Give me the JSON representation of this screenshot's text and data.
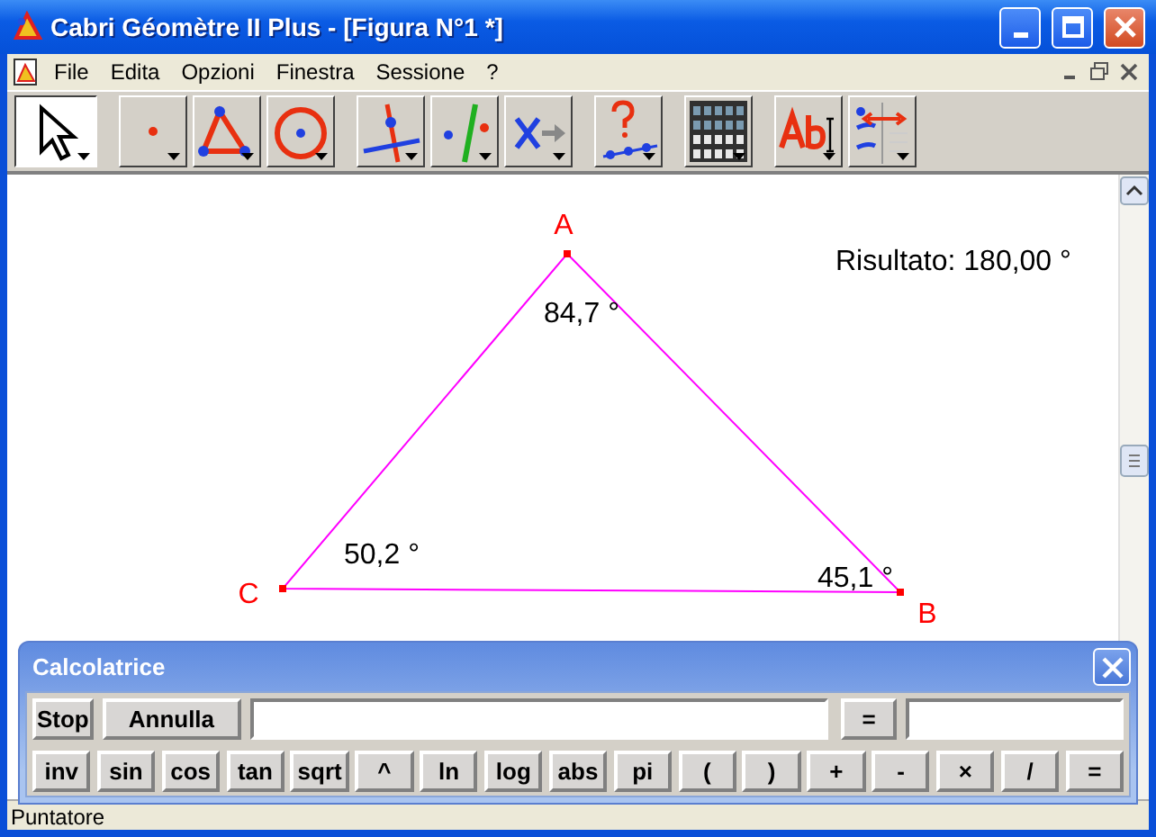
{
  "window": {
    "title": "Cabri Géomètre II Plus - [Figura N°1 *]"
  },
  "menu": [
    "File",
    "Edita",
    "Opzioni",
    "Finestra",
    "Sessione",
    "?"
  ],
  "toolbar": [
    {
      "kind": "pointer",
      "selected": true
    },
    {
      "kind": "point",
      "selected": false
    },
    {
      "kind": "polygon",
      "selected": false
    },
    {
      "kind": "circle",
      "selected": false
    },
    {
      "kind": "lines",
      "selected": false
    },
    {
      "kind": "parallel",
      "selected": false
    },
    {
      "kind": "transform",
      "selected": false
    },
    {
      "kind": "macro",
      "selected": false
    },
    {
      "kind": "calculator",
      "selected": false
    },
    {
      "kind": "text",
      "selected": false
    },
    {
      "kind": "display",
      "selected": false
    }
  ],
  "canvas": {
    "points": [
      {
        "label": "A"
      },
      {
        "label": "B"
      },
      {
        "label": "C"
      }
    ],
    "angles": [
      "84,7 °",
      "50,2 °",
      "45,1 °"
    ],
    "result": "Risultato: 180,00 °"
  },
  "calculator": {
    "title": "Calcolatrice",
    "actions": [
      "Stop",
      "Annulla"
    ],
    "equals": "=",
    "keys": [
      "inv",
      "sin",
      "cos",
      "tan",
      "sqrt",
      "^",
      "ln",
      "log",
      "abs",
      "pi",
      "(",
      ")",
      "+",
      "-",
      "×",
      "/",
      "="
    ]
  },
  "status_bar": "Puntatore"
}
